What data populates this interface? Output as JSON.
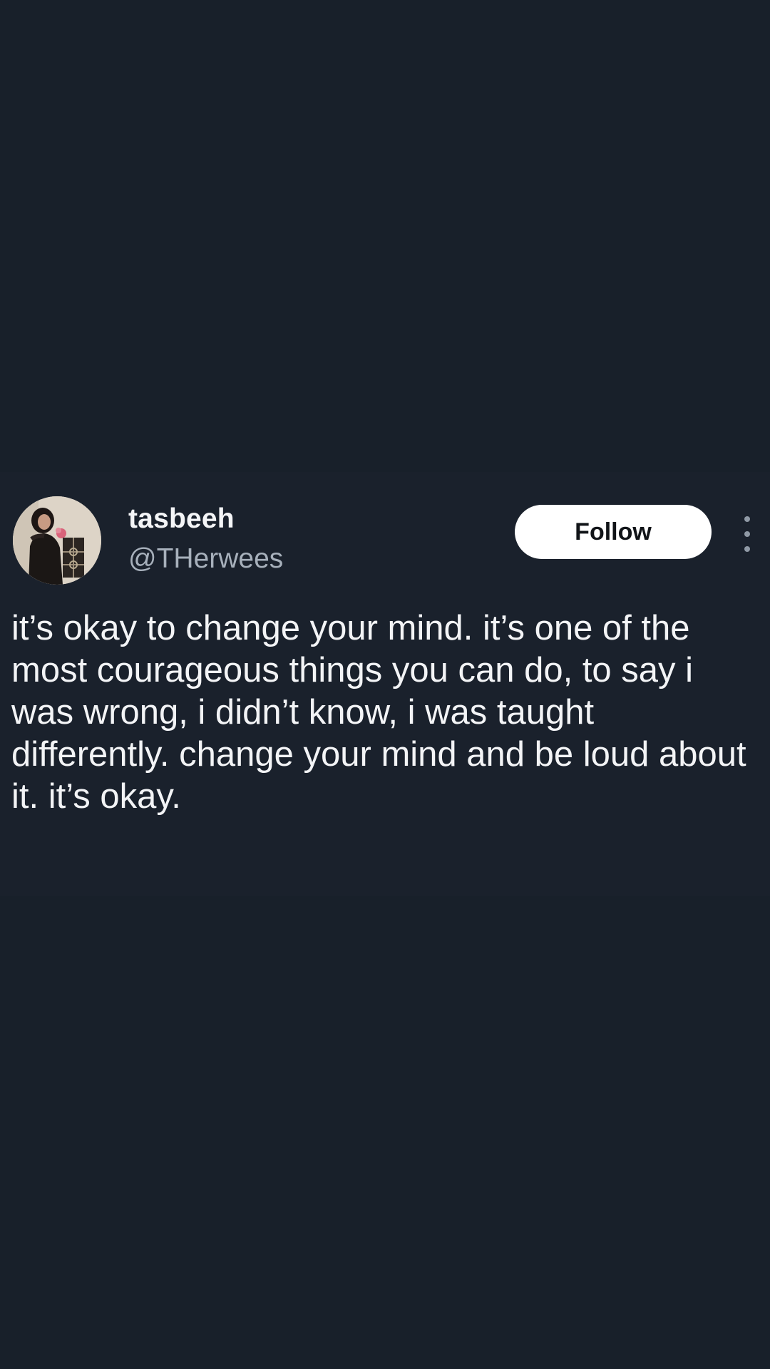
{
  "tweet": {
    "author": {
      "display_name": "tasbeeh",
      "handle": "@THerwees"
    },
    "follow_label": "Follow",
    "text": "it’s okay to change your mind. it’s one of the most courageous things you can do, to say i was wrong, i didn’t know, i was taught differently. change your mind and be loud about it. it’s okay."
  },
  "colors": {
    "background": "#18202a",
    "card": "#1a212c",
    "text": "#f3f4f6",
    "handle": "#a7b0bb",
    "follow_button": "#ffffff"
  },
  "icons": {
    "more": "vertical-ellipsis-icon",
    "avatar": "profile-photo"
  }
}
